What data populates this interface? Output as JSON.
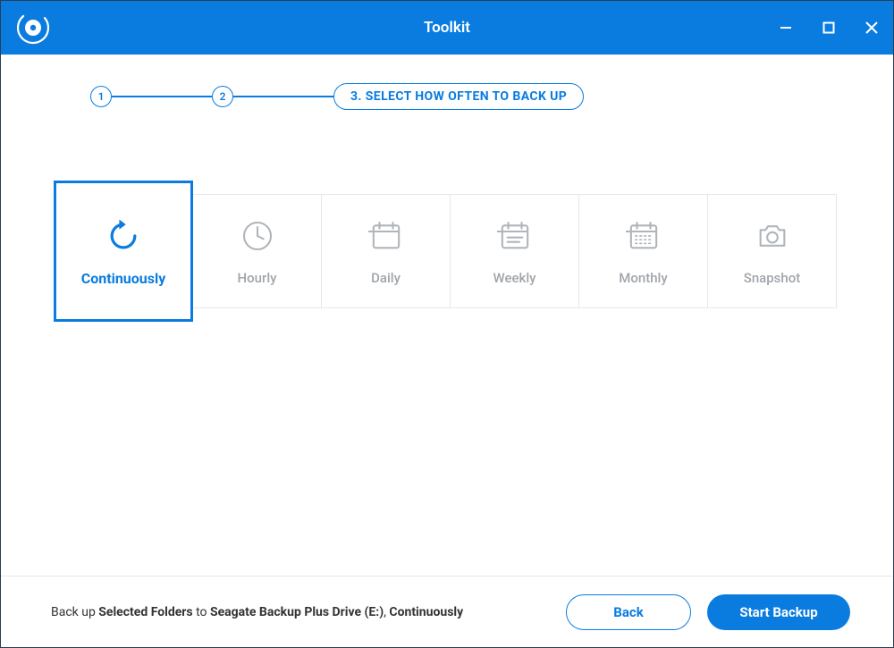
{
  "titlebar": {
    "title": "Toolkit"
  },
  "stepper": {
    "step1": "1",
    "step2": "2",
    "step3_label": "3. SELECT HOW OFTEN TO BACK UP"
  },
  "options": {
    "continuously": "Continuously",
    "hourly": "Hourly",
    "daily": "Daily",
    "weekly": "Weekly",
    "monthly": "Monthly",
    "snapshot": "Snapshot"
  },
  "footer": {
    "summary_prefix": "Back up ",
    "summary_folders": "Selected Folders",
    "summary_to": " to ",
    "summary_drive": "Seagate Backup Plus Drive (E:)",
    "summary_sep": ", ",
    "summary_frequency": "Continuously",
    "back_label": "Back",
    "start_label": "Start Backup"
  }
}
